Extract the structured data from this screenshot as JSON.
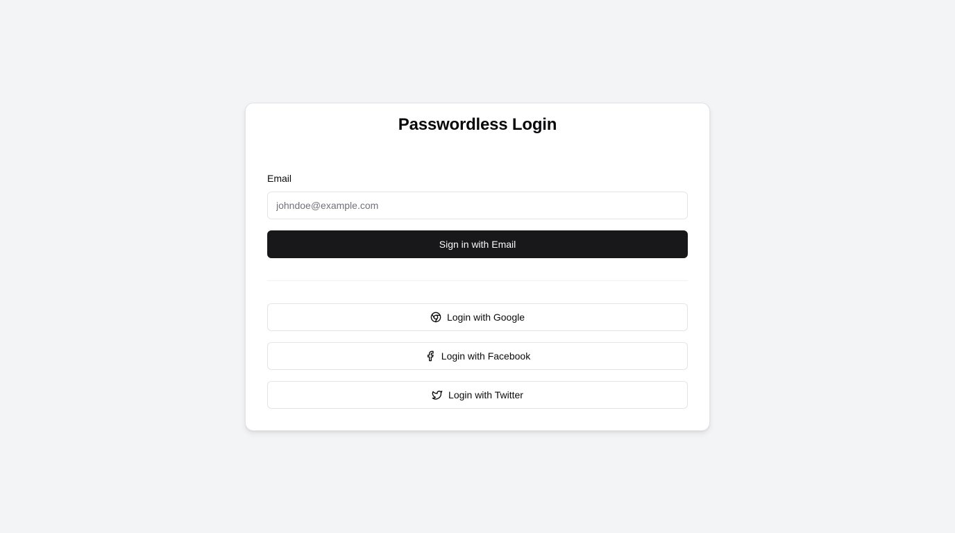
{
  "login": {
    "title": "Passwordless Login",
    "email_label": "Email",
    "email_placeholder": "johndoe@example.com",
    "email_value": "",
    "email_submit_label": "Sign in with Email"
  },
  "social": [
    {
      "label": "Login with Google",
      "icon": "chrome-icon"
    },
    {
      "label": "Login with Facebook",
      "icon": "facebook-icon"
    },
    {
      "label": "Login with Twitter",
      "icon": "twitter-icon"
    }
  ],
  "colors": {
    "background": "#f3f4f6",
    "card": "#ffffff",
    "primary_button": "#18181b",
    "primary_button_text": "#fafafa",
    "border": "#e4e4e7",
    "text": "#09090b",
    "placeholder": "#71717a"
  }
}
